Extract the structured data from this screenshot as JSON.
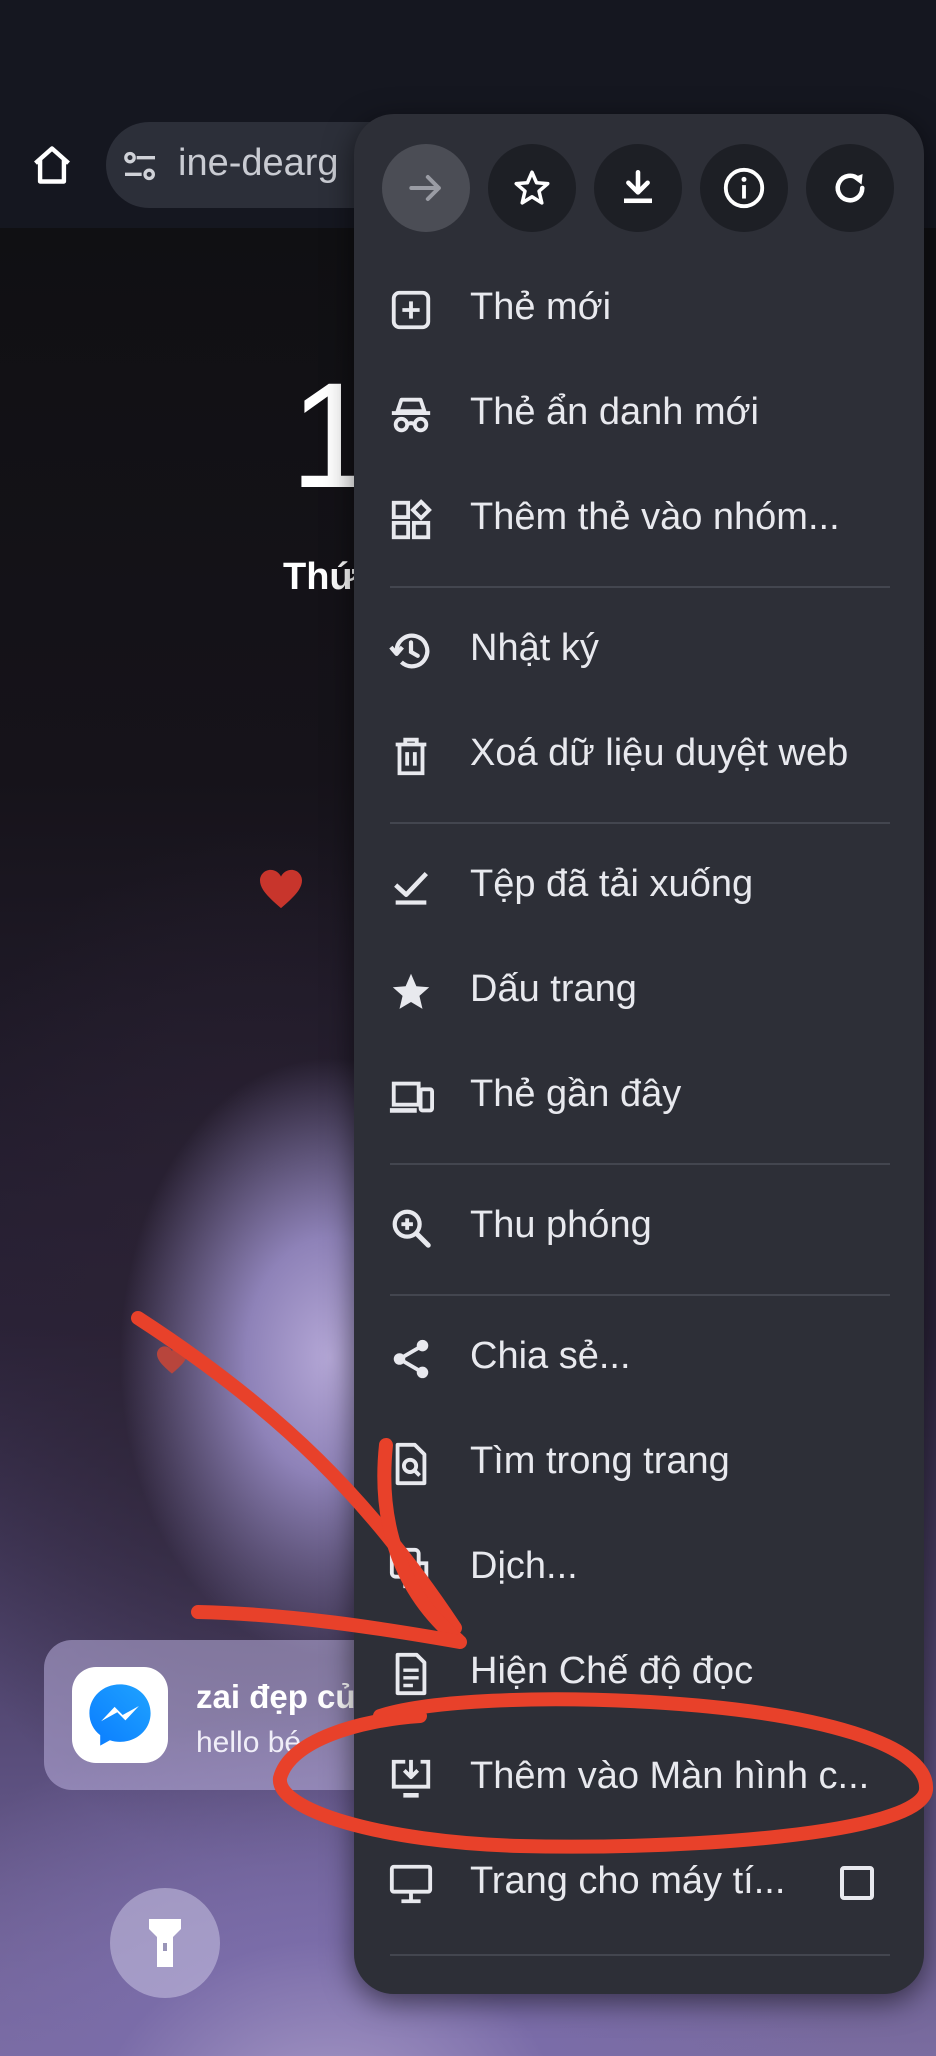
{
  "browser": {
    "url_fragment": "ine-dearg",
    "home_icon": "home-icon",
    "site_info_icon": "tune-icon"
  },
  "lockscreen": {
    "clock": "1",
    "date": "Thứ"
  },
  "notification": {
    "app_icon": "messenger-icon",
    "title": "zai đẹp củ",
    "body": "hello bé"
  },
  "menu": {
    "toolbar": [
      {
        "name": "forward",
        "icon": "arrow-right-icon"
      },
      {
        "name": "bookmark",
        "icon": "star-outline-icon"
      },
      {
        "name": "download",
        "icon": "download-icon"
      },
      {
        "name": "page-info",
        "icon": "info-icon"
      },
      {
        "name": "refresh",
        "icon": "refresh-icon"
      }
    ],
    "items": [
      {
        "label": "Thẻ mới",
        "icon": "new-tab-icon"
      },
      {
        "label": "Thẻ ẩn danh mới",
        "icon": "incognito-icon"
      },
      {
        "label": "Thêm thẻ vào nhóm...",
        "icon": "tab-group-icon"
      },
      {
        "label": "Nhật ký",
        "icon": "history-icon"
      },
      {
        "label": "Xoá dữ liệu duyệt web",
        "icon": "trash-icon"
      },
      {
        "label": "Tệp đã tải xuống",
        "icon": "downloads-icon"
      },
      {
        "label": "Dấu trang",
        "icon": "star-icon"
      },
      {
        "label": "Thẻ gần đây",
        "icon": "devices-icon"
      },
      {
        "label": "Thu phóng",
        "icon": "zoom-icon"
      },
      {
        "label": "Chia sẻ...",
        "icon": "share-icon"
      },
      {
        "label": "Tìm trong trang",
        "icon": "find-in-page-icon"
      },
      {
        "label": "Dịch...",
        "icon": "translate-icon"
      },
      {
        "label": "Hiện Chế độ đọc",
        "icon": "reader-mode-icon"
      },
      {
        "label": "Thêm vào Màn hình c...",
        "icon": "add-to-home-screen-icon"
      },
      {
        "label": "Trang cho máy tí...",
        "icon": "desktop-icon",
        "checkbox": false
      }
    ]
  },
  "colors": {
    "menu_bg": "#2d2f37",
    "annotation": "#e8412a"
  }
}
